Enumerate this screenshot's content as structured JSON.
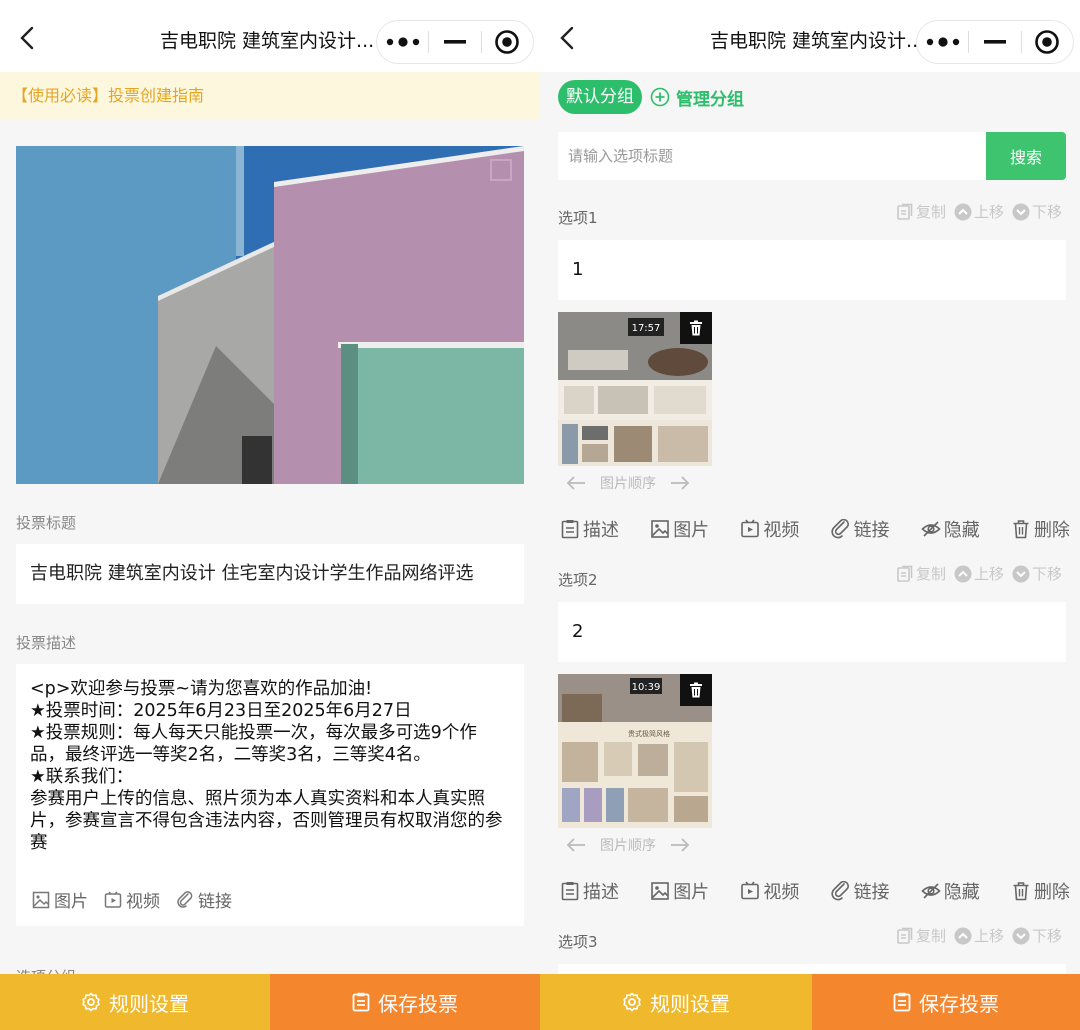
{
  "nav": {
    "title": "吉电职院 建筑室内设计..."
  },
  "left": {
    "notice": "【使用必读】投票创建指南",
    "title_label": "投票标题",
    "title_value": "吉电职院 建筑室内设计 住宅室内设计学生作品网络评选",
    "desc_label": "投票描述",
    "desc_value": "<p>欢迎参与投票~请为您喜欢的作品加油!\n★投票时间：2025年6月23日至2025年6月27日\n★投票规则：每人每天只能投票一次，每次最多可选9个作品，最终评选一等奖2名，二等奖3名，三等奖4名。\n★联系我们：\n参赛用户上传的信息、照片须为本人真实资料和本人真实照片，参赛宣言不得包含违法内容，否则管理员有权取消您的参赛",
    "tools": [
      "图片",
      "视频",
      "链接"
    ],
    "next_label": "选项分组"
  },
  "bottom": {
    "rule_label": "规则设置",
    "save_label": "保存投票"
  },
  "right": {
    "group_default": "默认分组",
    "group_manage": "管理分组",
    "search_placeholder": "请输入选项标题",
    "search_button": "搜索",
    "option_actions": [
      "复制",
      "上移",
      "下移"
    ],
    "order_label": "图片顺序",
    "option_tools": [
      "描述",
      "图片",
      "视频",
      "链接",
      "隐藏",
      "删除"
    ],
    "options": [
      {
        "label": "选项1",
        "value": "1",
        "thumb_time": "17:57"
      },
      {
        "label": "选项2",
        "value": "2",
        "thumb_time": "10:39",
        "thumb_caption": "贵式极简风格"
      },
      {
        "label": "选项3"
      }
    ]
  },
  "colors": {
    "green": "#2dbe6c",
    "orange": "#f4862e",
    "yellow": "#f0b92d",
    "notice_text": "#e5a522"
  }
}
